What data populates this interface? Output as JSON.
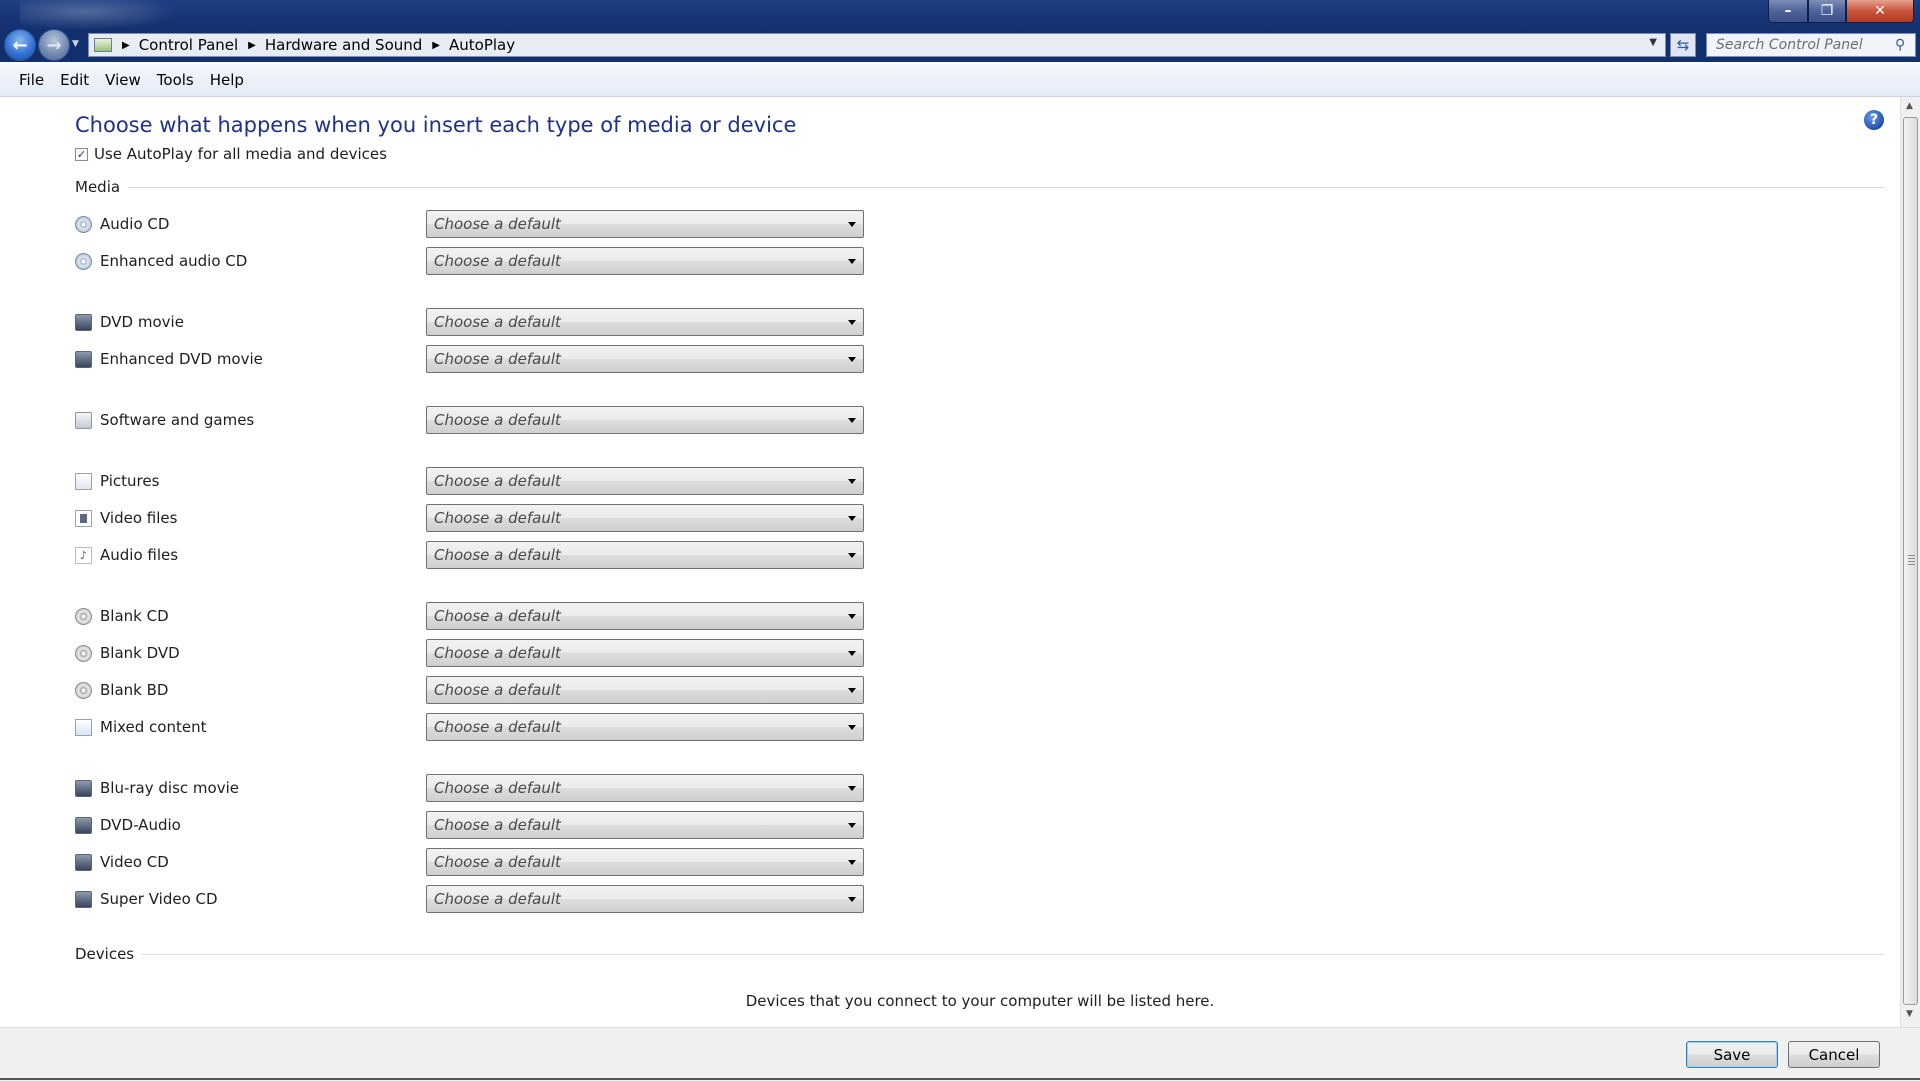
{
  "window": {
    "caption_buttons": {
      "minimize": "–",
      "maximize": "❐",
      "close": "✕"
    }
  },
  "address": {
    "breadcrumbs": [
      "Control Panel",
      "Hardware and Sound",
      "AutoPlay"
    ],
    "search_placeholder": "Search Control Panel"
  },
  "menu": [
    "File",
    "Edit",
    "View",
    "Tools",
    "Help"
  ],
  "main": {
    "heading": "Choose what happens when you insert each type of media or device",
    "use_autoplay_label": "Use AutoPlay for all media and devices",
    "use_autoplay_checked": true,
    "media_group_label": "Media",
    "devices_group_label": "Devices",
    "devices_message": "Devices that you connect to your computer will be listed here.",
    "dropdown_default": "Choose a default",
    "media_items": [
      {
        "label": "Audio CD",
        "icon": "audio-cd-icon"
      },
      {
        "label": "Enhanced audio CD",
        "icon": "enhanced-audio-cd-icon"
      },
      {
        "label": "DVD movie",
        "icon": "dvd-movie-icon"
      },
      {
        "label": "Enhanced DVD movie",
        "icon": "enhanced-dvd-movie-icon"
      },
      {
        "label": "Software and games",
        "icon": "software-icon"
      },
      {
        "label": "Pictures",
        "icon": "pictures-icon"
      },
      {
        "label": "Video files",
        "icon": "video-files-icon"
      },
      {
        "label": "Audio files",
        "icon": "audio-files-icon"
      },
      {
        "label": "Blank CD",
        "icon": "blank-cd-icon"
      },
      {
        "label": "Blank DVD",
        "icon": "blank-dvd-icon"
      },
      {
        "label": "Blank BD",
        "icon": "blank-bd-icon"
      },
      {
        "label": "Mixed content",
        "icon": "mixed-content-icon"
      },
      {
        "label": "Blu-ray disc movie",
        "icon": "bluray-movie-icon"
      },
      {
        "label": "DVD-Audio",
        "icon": "dvd-audio-icon"
      },
      {
        "label": "Video CD",
        "icon": "video-cd-icon"
      },
      {
        "label": "Super Video CD",
        "icon": "super-video-cd-icon"
      }
    ]
  },
  "footer": {
    "save_label": "Save",
    "cancel_label": "Cancel"
  }
}
